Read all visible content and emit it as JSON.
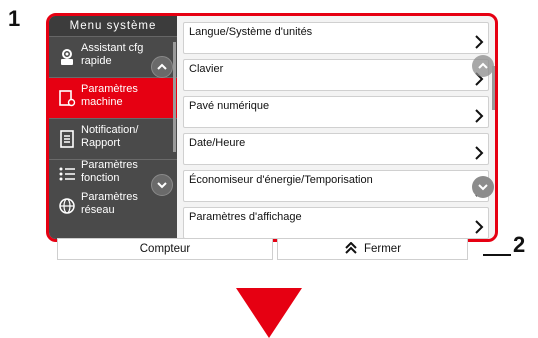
{
  "callouts": {
    "one": "1",
    "two": "2"
  },
  "sidebar": {
    "title": "Menu système",
    "items": [
      {
        "label": "Assistant cfg rapide",
        "icon": "gear-wizard-icon",
        "active": false
      },
      {
        "label": "Paramètres machine",
        "icon": "device-settings-icon",
        "active": true
      },
      {
        "label": "Notification/ Rapport",
        "icon": "report-icon",
        "active": false
      },
      {
        "label": "Paramètres fonction",
        "icon": "list-settings-icon",
        "active": false
      },
      {
        "label": "Paramètres réseau",
        "icon": "globe-network-icon",
        "active": false
      }
    ]
  },
  "list": {
    "items": [
      {
        "label": "Langue/Système d'unités"
      },
      {
        "label": "Clavier"
      },
      {
        "label": "Pavé numérique"
      },
      {
        "label": "Date/Heure"
      },
      {
        "label": "Économiseur d'énergie/Temporisation"
      },
      {
        "label": "Paramètres d'affichage"
      }
    ]
  },
  "footer": {
    "counter_label": "Compteur",
    "close_label": "Fermer"
  },
  "colors": {
    "accent": "#e60012",
    "sidebar": "#4a4a4a",
    "panel": "#f3f3f3"
  }
}
